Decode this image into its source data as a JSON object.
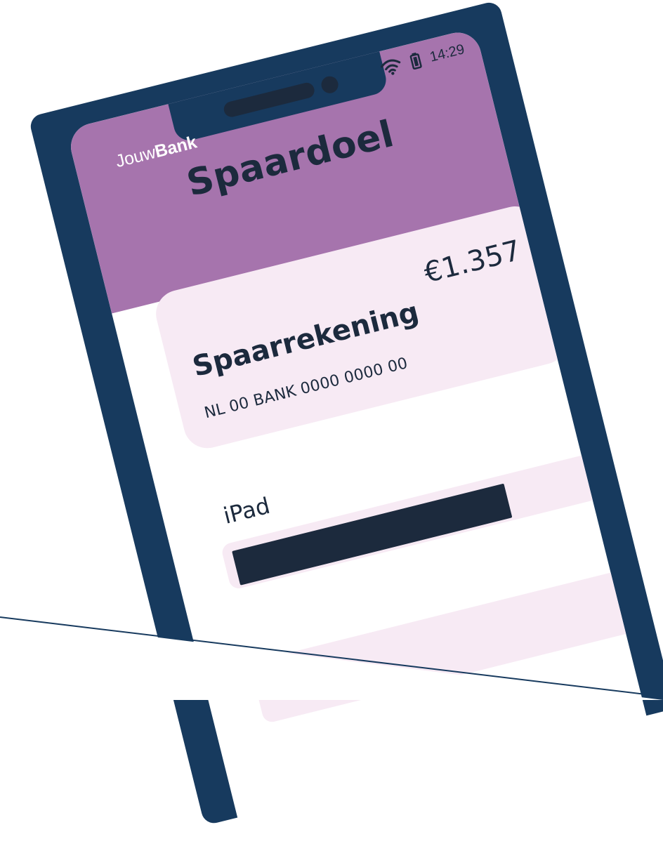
{
  "status_bar": {
    "time": "14:29"
  },
  "brand": {
    "prefix": "Jouw",
    "bold": "Bank"
  },
  "page_title": "Spaardoel",
  "account": {
    "name": "Spaarrekening",
    "balance": "€1.357",
    "iban": "NL 00 BANK 0000 0000 00"
  },
  "goals": [
    {
      "label": "iPad",
      "progress": 0.73
    }
  ],
  "colors": {
    "phone_frame": "#173a5e",
    "header": "#a674ad",
    "card": "#f7eaf4",
    "text_dark": "#1c2a3d"
  }
}
